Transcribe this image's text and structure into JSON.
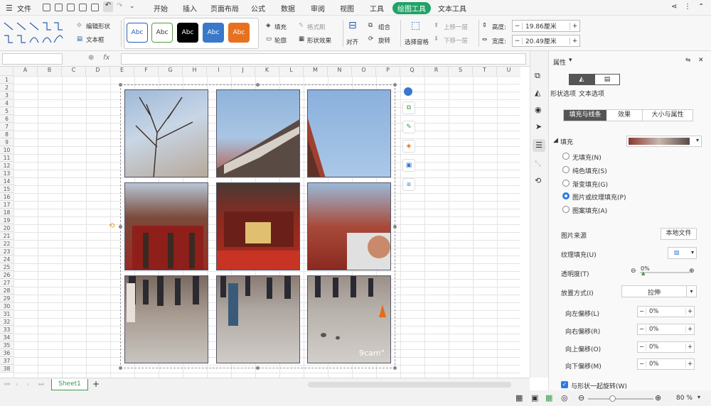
{
  "menubar": {
    "file": "文件",
    "tabs": [
      "开始",
      "插入",
      "页面布局",
      "公式",
      "数据",
      "审阅",
      "视图",
      "工具",
      "绘图工具",
      "文本工具"
    ]
  },
  "ribbon": {
    "edit_shape": "编辑形状",
    "text_box": "文本框",
    "styles": [
      "Abc",
      "Abc",
      "Abc",
      "Abc",
      "Abc"
    ],
    "fill": "填充",
    "outline": "轮廓",
    "format_painter": "格式刷",
    "shape_effect": "形状效果",
    "align": "对齐",
    "group": "组合",
    "rotate": "旋转",
    "selection_pane": "选择窗格",
    "bring_forward": "上移一层",
    "send_backward": "下移一层",
    "height_label": "高度:",
    "height_value": "19.86厘米",
    "width_label": "宽度:",
    "width_value": "20.49厘米"
  },
  "formula": {
    "fx": "fx"
  },
  "columns": [
    "A",
    "B",
    "C",
    "D",
    "E",
    "F",
    "G",
    "H",
    "I",
    "J",
    "K",
    "L",
    "M",
    "N",
    "O",
    "P",
    "Q",
    "R",
    "S",
    "T",
    "U"
  ],
  "rows": [
    "1",
    "2",
    "3",
    "4",
    "5",
    "6",
    "7",
    "8",
    "9",
    "10",
    "11",
    "12",
    "13",
    "14",
    "15",
    "16",
    "17",
    "18",
    "19",
    "20",
    "21",
    "22",
    "23",
    "24",
    "25",
    "26",
    "27",
    "28",
    "29",
    "30",
    "31",
    "32",
    "33",
    "34",
    "35",
    "36",
    "37",
    "38"
  ],
  "watermark": "9cam°",
  "sheet_tab": "Sheet1",
  "panel": {
    "title": "属性",
    "tab_shape": "形状选项",
    "tab_text": "文本选项",
    "subtabs": [
      "填充与线条",
      "效果",
      "大小与属性"
    ],
    "fill_header": "填充",
    "fill_options": [
      "无填充(N)",
      "纯色填充(S)",
      "渐变填充(G)",
      "图片或纹理填充(P)",
      "图案填充(A)"
    ],
    "fill_selected": 3,
    "image_source": "图片来源",
    "local_file": "本地文件",
    "texture_fill": "纹理填充(U)",
    "transparency": "透明度(T)",
    "transparency_value": "0%",
    "placement": "放置方式(I)",
    "placement_value": "拉伸",
    "offset_left": "向左偏移(L)",
    "offset_right": "向右偏移(R)",
    "offset_up": "向上偏移(O)",
    "offset_down": "向下偏移(M)",
    "offset_values": [
      "0%",
      "0%",
      "0%",
      "0%"
    ],
    "rotate_with_shape": "与形状一起旋转(W)"
  },
  "status": {
    "zoom": "80 %"
  }
}
